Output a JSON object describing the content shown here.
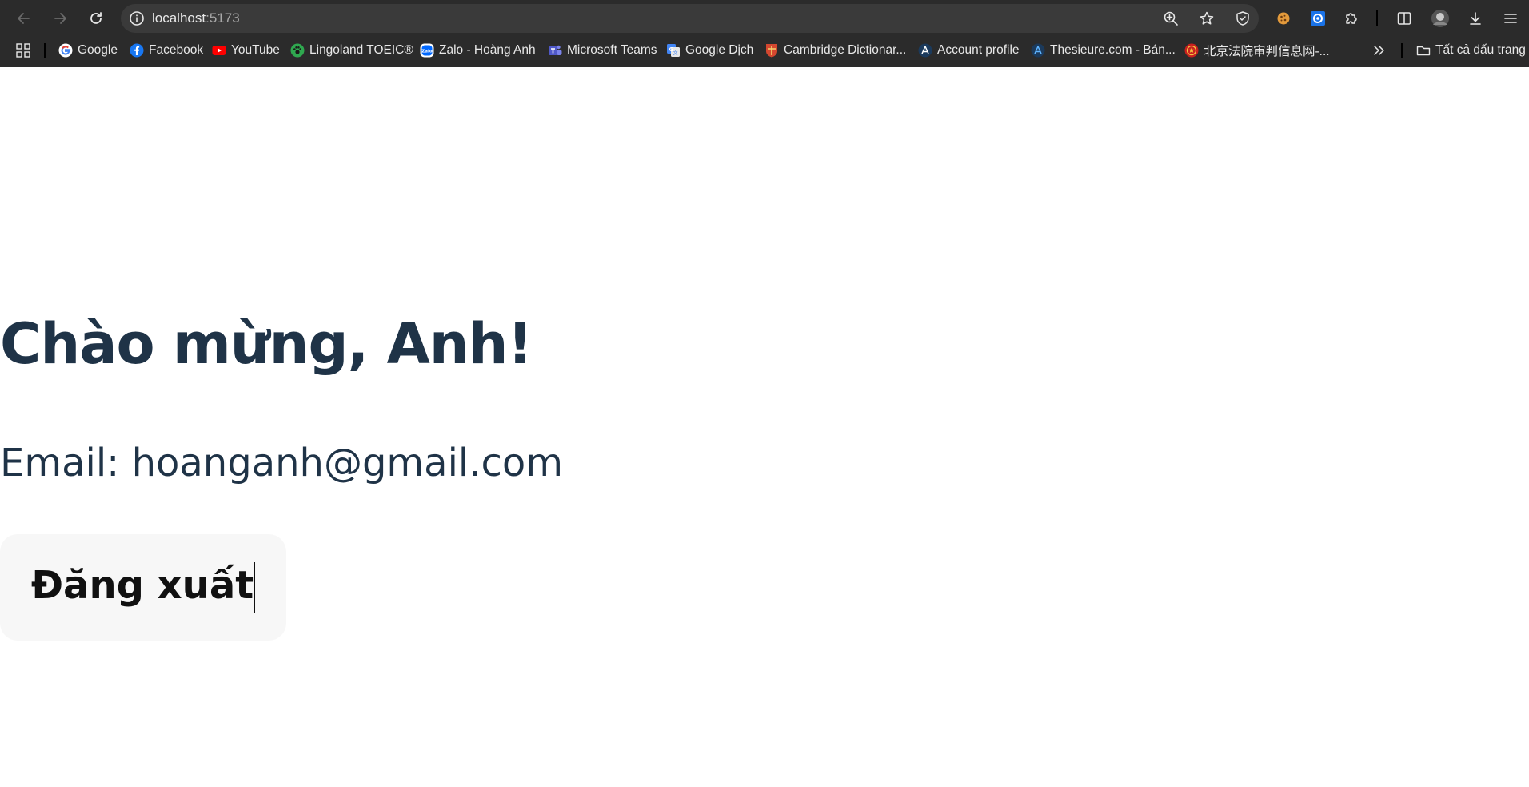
{
  "browser": {
    "address": {
      "host": "localhost",
      "port": ":5173"
    },
    "bookmarks": [
      {
        "label": "Google",
        "icon": "google-icon"
      },
      {
        "label": "Facebook",
        "icon": "facebook-icon"
      },
      {
        "label": "YouTube",
        "icon": "youtube-icon"
      },
      {
        "label": "Lingoland TOEIC®",
        "icon": "paw-icon"
      },
      {
        "label": "Zalo - Hoàng Anh",
        "icon": "zalo-icon"
      },
      {
        "label": "Microsoft Teams",
        "icon": "teams-icon"
      },
      {
        "label": "Google Dịch",
        "icon": "google-translate-icon"
      },
      {
        "label": "Cambridge Dictionar...",
        "icon": "cambridge-icon"
      },
      {
        "label": "Account profile",
        "icon": "account-icon"
      },
      {
        "label": "Thesieure.com - Bán...",
        "icon": "thesieure-icon"
      },
      {
        "label": "北京法院审判信息网-...",
        "icon": "court-emblem-icon"
      }
    ],
    "all_bookmarks_label": "Tất cả dấu trang",
    "colors": {
      "chrome_bg": "#2b2b2b",
      "address_bg": "#3a3a3a"
    }
  },
  "page": {
    "heading": "Chào mừng, Anh!",
    "email_line": "Email: hoanganh@gmail.com",
    "logout_label": "Đăng xuất",
    "colors": {
      "text": "#1f3347",
      "button_bg": "#f7f7f7"
    }
  }
}
